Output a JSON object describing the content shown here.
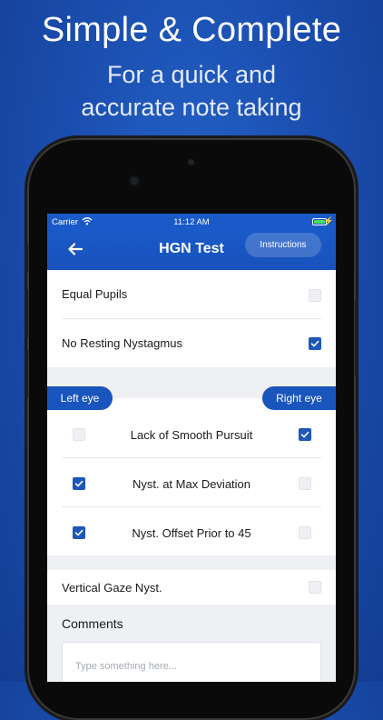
{
  "promo": {
    "headline": "Simple & Complete",
    "subline_1": "For a quick and",
    "subline_2": "accurate note taking"
  },
  "status_bar": {
    "carrier": "Carrier",
    "time": "11:12 AM",
    "battery_level": 1.0
  },
  "nav": {
    "title": "HGN Test",
    "instructions_label": "Instructions",
    "back_icon": "arrow-left-icon"
  },
  "general_checks": [
    {
      "label": "Equal Pupils",
      "checked": false
    },
    {
      "label": "No Resting Nystagmus",
      "checked": true
    }
  ],
  "eye_tabs": {
    "left": "Left eye",
    "right": "Right eye"
  },
  "eye_checks": [
    {
      "label": "Lack of Smooth Pursuit",
      "left": false,
      "right": true
    },
    {
      "label": "Nyst. at Max Deviation",
      "left": true,
      "right": false
    },
    {
      "label": "Nyst. Offset Prior to 45",
      "left": true,
      "right": false
    }
  ],
  "vertical_gaze": {
    "label": "Vertical Gaze Nyst.",
    "checked": false
  },
  "comments": {
    "title": "Comments",
    "placeholder": "Type something here..."
  },
  "colors": {
    "primary": "#1a5ac8",
    "checkbox_on": "#1d57b8",
    "background": "#1b4fb0"
  }
}
